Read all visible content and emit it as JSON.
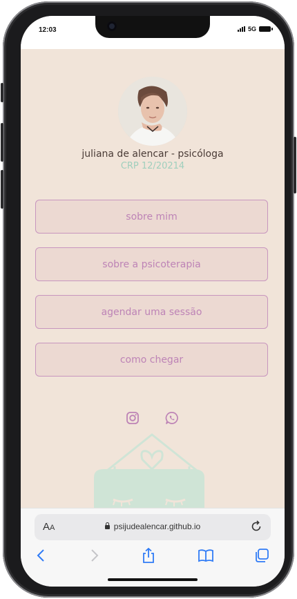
{
  "status": {
    "time": "12:03",
    "network": "5G"
  },
  "profile": {
    "name": "juliana de alencar - psicóloga",
    "crp": "CRP 12/20214"
  },
  "links": [
    {
      "label": "sobre mim"
    },
    {
      "label": "sobre a psicoterapia"
    },
    {
      "label": "agendar uma sessão"
    },
    {
      "label": "como chegar"
    }
  ],
  "social": [
    "instagram-icon",
    "whatsapp-icon"
  ],
  "browser": {
    "text_size_label_big": "A",
    "text_size_label_small": "A",
    "url": "psijudealencar.github.io"
  },
  "colors": {
    "background": "#f1e4d9",
    "accent": "#bd83b6",
    "crp": "#9fcfbd",
    "button_fill": "#ecd9d2"
  }
}
